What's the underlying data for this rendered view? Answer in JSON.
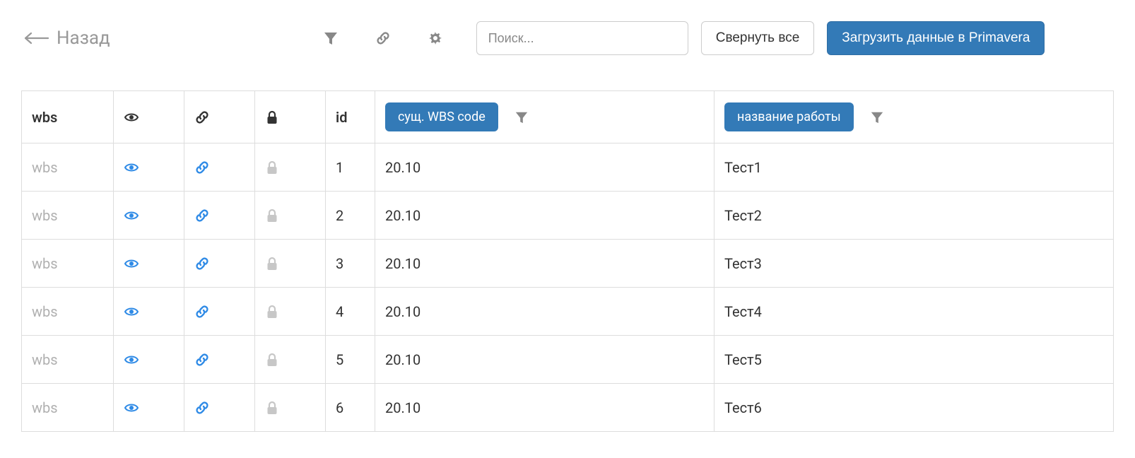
{
  "toolbar": {
    "back_label": "Назад",
    "search_placeholder": "Поиск...",
    "collapse_label": "Свернуть все",
    "load_label": "Загрузить данные в Primavera"
  },
  "table": {
    "headers": {
      "wbs": "wbs",
      "id": "id",
      "wbs_code": "сущ. WBS code",
      "work_name": "название работы"
    },
    "rows": [
      {
        "wbs": "wbs",
        "id": "1",
        "wbs_code": "20.10",
        "name": "Тест1"
      },
      {
        "wbs": "wbs",
        "id": "2",
        "wbs_code": "20.10",
        "name": "Тест2"
      },
      {
        "wbs": "wbs",
        "id": "3",
        "wbs_code": "20.10",
        "name": "Тест3"
      },
      {
        "wbs": "wbs",
        "id": "4",
        "wbs_code": "20.10",
        "name": "Тест4"
      },
      {
        "wbs": "wbs",
        "id": "5",
        "wbs_code": "20.10",
        "name": "Тест5"
      },
      {
        "wbs": "wbs",
        "id": "6",
        "wbs_code": "20.10",
        "name": "Тест6"
      }
    ]
  }
}
